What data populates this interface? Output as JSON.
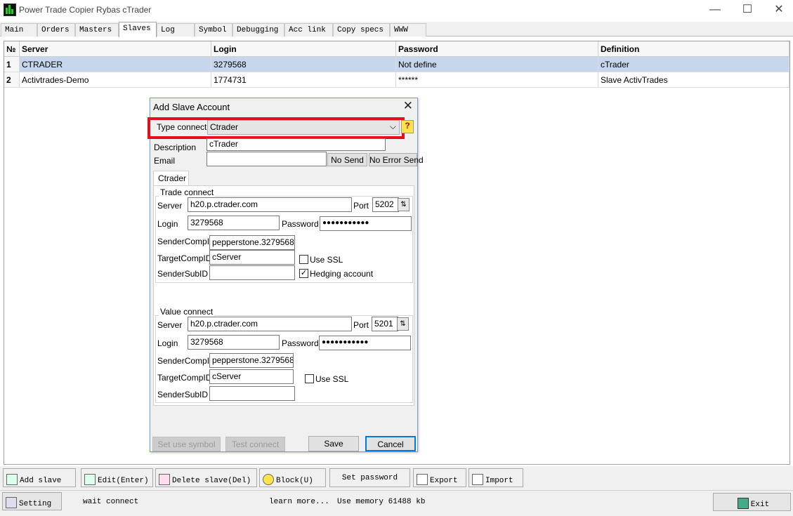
{
  "window": {
    "title": "Power Trade Copier Rybas cTrader",
    "minimize": "—",
    "maximize": "☐",
    "close": "✕"
  },
  "tabs": [
    "Main",
    "Orders",
    "Masters",
    "Slaves",
    "Log",
    "Symbol",
    "Debugging",
    "Acc link",
    "Copy specs",
    "WWW"
  ],
  "active_tab": "Slaves",
  "grid": {
    "headers": [
      "№",
      "Server",
      "Login",
      "Password",
      "Definition"
    ],
    "rows": [
      [
        "1",
        "CTRADER",
        "3279568",
        "Not define",
        "cTrader"
      ],
      [
        "2",
        "Activtrades-Demo",
        "1774731",
        "******",
        "Slave ActivTrades"
      ]
    ]
  },
  "dialog": {
    "title": "Add Slave Account",
    "close": "✕",
    "type_connect_label": "Type connect",
    "type_connect_value": "Ctrader",
    "help_icon": "?",
    "description_label": "Description",
    "description_value": "cTrader",
    "email_label": "Email",
    "email_value": "",
    "no_send": "No Send",
    "no_error_send": "No Error Send",
    "inner_tab": "Ctrader",
    "trade": {
      "group": "Trade connect",
      "server_label": "Server",
      "server": "h20.p.ctrader.com",
      "port_label": "Port",
      "port": "5202",
      "login_label": "Login",
      "login": "3279568",
      "password_label": "Password",
      "password": "●●●●●●●●●●●",
      "sendercomp_label": "SenderCompID",
      "sendercomp": "pepperstone.3279568",
      "targetcomp_label": "TargetCompID",
      "targetcomp": "cServer",
      "sendersub_label": "SenderSubID",
      "sendersub": "",
      "use_ssl": "Use SSL",
      "use_ssl_checked": false,
      "hedging": "Hedging account",
      "hedging_checked": true
    },
    "value": {
      "group": "Value connect",
      "server_label": "Server",
      "server": "h20.p.ctrader.com",
      "port_label": "Port",
      "port": "5201",
      "login_label": "Login",
      "login": "3279568",
      "password_label": "Password",
      "password": "●●●●●●●●●●●",
      "sendercomp_label": "SenderCompID",
      "sendercomp": "pepperstone.3279568",
      "targetcomp_label": "TargetCompID",
      "targetcomp": "cServer",
      "sendersub_label": "SenderSubID",
      "sendersub": "",
      "use_ssl": "Use SSL",
      "use_ssl_checked": false
    },
    "set_use_symbol": "Set use symbol",
    "test_connect": "Test connect",
    "save": "Save",
    "cancel": "Cancel",
    "highlight_color": "#e0101c"
  },
  "toolbar": [
    "Add slave",
    "Edit(Enter)",
    "Delete slave(Del)",
    "Block(U)",
    "Set password",
    "Export",
    "Import"
  ],
  "status": {
    "setting": "Setting",
    "connection": "wait connect",
    "learn_more": "learn more...",
    "memory": "Use memory 61488 kb",
    "exit": "Exit"
  }
}
